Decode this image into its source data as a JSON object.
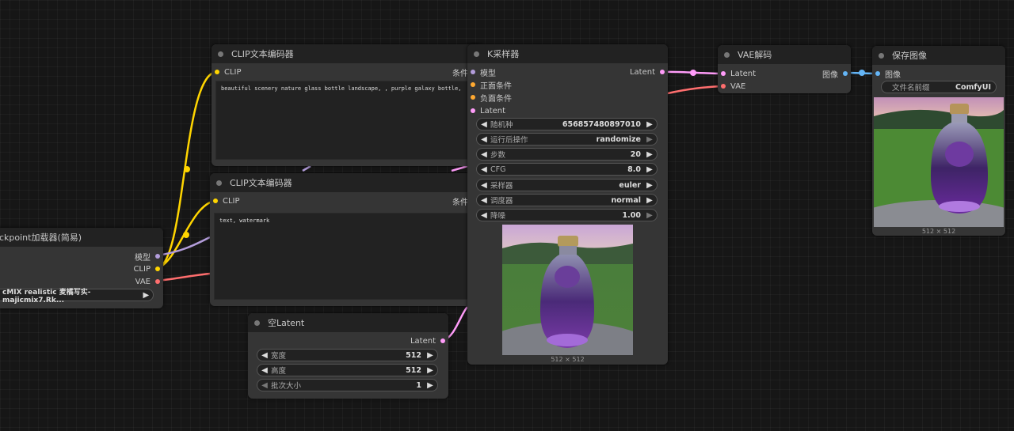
{
  "colors": {
    "canvas": "#161616",
    "node_bg": "#353535",
    "title_bg": "#222222",
    "model": "#b39ddb",
    "clip": "#ffd500",
    "vae": "#ff6e6e",
    "conditioning": "#ffa931",
    "latent": "#ff9cf9",
    "image": "#64b5f6"
  },
  "checkpoint": {
    "title": "ckpoint加载器(简易)",
    "out_model": "模型",
    "out_clip": "CLIP",
    "out_vae": "VAE",
    "ckpt_value": "cMIX realistic 麦橘写实-majicmix7.Rk..."
  },
  "clip_pos": {
    "title": "CLIP文本编码器",
    "in_clip": "CLIP",
    "out_cond": "条件",
    "text": "beautiful scenery nature glass bottle landscape, , purple galaxy bottle,"
  },
  "clip_neg": {
    "title": "CLIP文本编码器",
    "in_clip": "CLIP",
    "out_cond": "条件",
    "text": "text, watermark"
  },
  "empty_latent": {
    "title": "空Latent",
    "out_latent": "Latent",
    "width_label": "宽度",
    "width_value": "512",
    "height_label": "高度",
    "height_value": "512",
    "batch_label": "批次大小",
    "batch_value": "1"
  },
  "ksampler": {
    "title": "K采样器",
    "in_model": "模型",
    "in_positive": "正面条件",
    "in_negative": "负面条件",
    "in_latent": "Latent",
    "out_latent": "Latent",
    "seed_label": "随机种",
    "seed_value": "656857480897010",
    "control_label": "运行后操作",
    "control_value": "randomize",
    "steps_label": "步数",
    "steps_value": "20",
    "cfg_label": "CFG",
    "cfg_value": "8.0",
    "sampler_label": "采样器",
    "sampler_value": "euler",
    "scheduler_label": "调度器",
    "scheduler_value": "normal",
    "denoise_label": "降噪",
    "denoise_value": "1.00",
    "preview_size": "512 × 512"
  },
  "vae_decode": {
    "title": "VAE解码",
    "in_latent": "Latent",
    "in_vae": "VAE",
    "out_image": "图像"
  },
  "save_image": {
    "title": "保存图像",
    "in_image": "图像",
    "prefix_label": "文件名前缀",
    "prefix_value": "ComfyUI",
    "preview_size": "512 × 512"
  }
}
